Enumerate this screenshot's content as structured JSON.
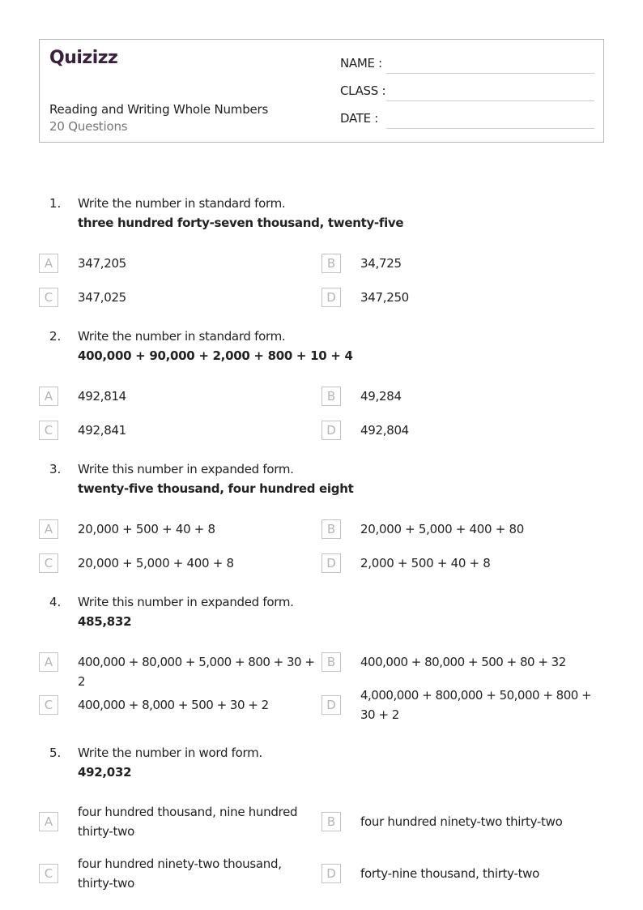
{
  "header": {
    "logo": "Quizizz",
    "worksheet_title": "Reading and Writing Whole Numbers",
    "question_count": "20 Questions",
    "fields": [
      {
        "label": "NAME :"
      },
      {
        "label": "CLASS :"
      },
      {
        "label": "DATE  :"
      }
    ]
  },
  "colors": {
    "logo": "#3b1f3e",
    "border": "#b5b5b5",
    "option_letter": "#b5b5b5",
    "subtitle": "#777777"
  },
  "questions": [
    {
      "number": "1.",
      "prompt": "Write the number in standard form.",
      "bold": "three hundred forty-seven thousand, twenty-five",
      "options": [
        {
          "letter": "A",
          "text": "347,205"
        },
        {
          "letter": "B",
          "text": "34,725"
        },
        {
          "letter": "C",
          "text": "347,025"
        },
        {
          "letter": "D",
          "text": "347,250"
        }
      ]
    },
    {
      "number": "2.",
      "prompt": "Write the number in standard form.",
      "bold": "400,000 + 90,000 + 2,000 + 800 + 10 + 4",
      "options": [
        {
          "letter": "A",
          "text": "492,814"
        },
        {
          "letter": "B",
          "text": "49,284"
        },
        {
          "letter": "C",
          "text": "492,841"
        },
        {
          "letter": "D",
          "text": "492,804"
        }
      ]
    },
    {
      "number": "3.",
      "prompt": "Write this number in expanded form.",
      "bold": "twenty-five thousand, four hundred eight",
      "options": [
        {
          "letter": "A",
          "text": "20,000 + 500 + 40 + 8"
        },
        {
          "letter": "B",
          "text": "20,000 + 5,000 + 400 + 80"
        },
        {
          "letter": "C",
          "text": "20,000 + 5,000 + 400 + 8"
        },
        {
          "letter": "D",
          "text": "2,000 + 500 + 40 + 8"
        }
      ]
    },
    {
      "number": "4.",
      "prompt": "Write this number in expanded form.",
      "bold": "485,832",
      "options": [
        {
          "letter": "A",
          "text": "400,000 + 80,000 + 5,000 + 800 + 30 + 2"
        },
        {
          "letter": "B",
          "text": "400,000 + 80,000 + 500 + 80 + 32"
        },
        {
          "letter": "C",
          "text": "400,000 + 8,000 + 500 + 30 + 2"
        },
        {
          "letter": "D",
          "text": "4,000,000 + 800,000 + 50,000 + 800 + 30 + 2"
        }
      ]
    },
    {
      "number": "5.",
      "prompt": "Write the number in word form.",
      "bold": "492,032",
      "options": [
        {
          "letter": "A",
          "text": "four hundred thousand, nine hundred thirty-two"
        },
        {
          "letter": "B",
          "text": "four hundred ninety-two thirty-two"
        },
        {
          "letter": "C",
          "text": "four hundred ninety-two thousand, thirty-two"
        },
        {
          "letter": "D",
          "text": "forty-nine thousand, thirty-two"
        }
      ]
    }
  ]
}
